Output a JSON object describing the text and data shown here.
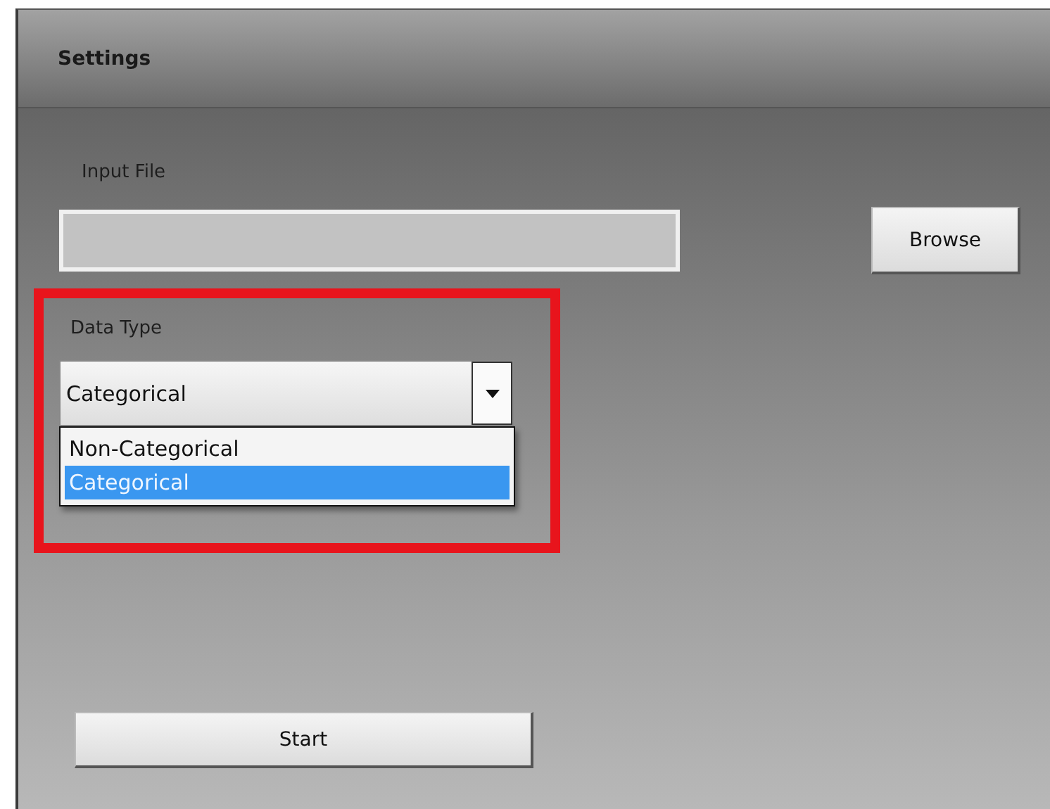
{
  "window": {
    "title": "Settings"
  },
  "input_file": {
    "label": "Input File"
  },
  "browse_button": "Browse",
  "data_type": {
    "label": "Data Type",
    "value": "Categorical",
    "expanded": true,
    "highlighted": true,
    "options": [
      {
        "label": "Non-Categorical",
        "selected": false
      },
      {
        "label": "Categorical",
        "selected": true
      }
    ]
  },
  "start_button": "Start"
}
